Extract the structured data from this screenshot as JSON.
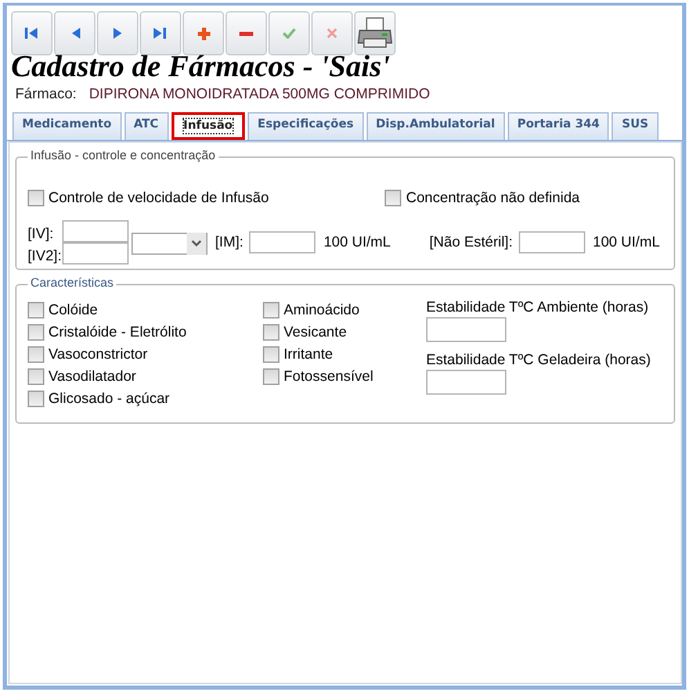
{
  "toolbar": [
    {
      "kind": "first",
      "disabled": false
    },
    {
      "kind": "prev",
      "disabled": false
    },
    {
      "kind": "next",
      "disabled": false
    },
    {
      "kind": "last",
      "disabled": false
    },
    {
      "kind": "add",
      "disabled": false
    },
    {
      "kind": "remove",
      "disabled": false
    },
    {
      "kind": "confirm",
      "disabled": true
    },
    {
      "kind": "cancel",
      "disabled": true
    },
    {
      "kind": "print",
      "disabled": false
    }
  ],
  "title": "Cadastro de Fármacos - 'Sais'",
  "drug": {
    "label": "Fármaco:",
    "value": "DIPIRONA MONOIDRATADA 500MG COMPRIMIDO"
  },
  "tabs": [
    {
      "label": "Medicamento",
      "selected": false
    },
    {
      "label": "ATC",
      "selected": false
    },
    {
      "label": "Infusão",
      "selected": true
    },
    {
      "label": "Especificações",
      "selected": false
    },
    {
      "label": "Disp.Ambulatorial",
      "selected": false
    },
    {
      "label": "Portaria 344",
      "selected": false
    },
    {
      "label": "SUS",
      "selected": false
    }
  ],
  "infusion": {
    "legend": "Infusão - controle e concentração",
    "speed_control": {
      "label": "Controle de velocidade de Infusão",
      "checked": false
    },
    "undefined_concentration": {
      "label": "Concentração não definida",
      "checked": false
    },
    "iv_label": "[IV]:",
    "iv2_label": "[IV2]:",
    "im_label": "[IM]:",
    "im_unit": "100 UI/mL",
    "non_sterile_label": "[Não Estéril]:",
    "non_sterile_unit": "100 UI/mL"
  },
  "characteristics": {
    "legend": "Características",
    "column_1": [
      {
        "label": "Colóide",
        "checked": false
      },
      {
        "label": "Cristalóide - Eletrólito",
        "checked": false
      },
      {
        "label": "Vasoconstrictor",
        "checked": false
      },
      {
        "label": "Vasodilatador",
        "checked": false
      },
      {
        "label": "Glicosado - açúcar",
        "checked": false
      }
    ],
    "column_2": [
      {
        "label": "Aminoácido",
        "checked": false
      },
      {
        "label": "Vesicante",
        "checked": false
      },
      {
        "label": "Irritante",
        "checked": false
      },
      {
        "label": "Fotossensível",
        "checked": false
      }
    ],
    "ambient_label": "Estabilidade TºC Ambiente (horas)",
    "fridge_label": "Estabilidade TºC Geladeira (horas)"
  }
}
